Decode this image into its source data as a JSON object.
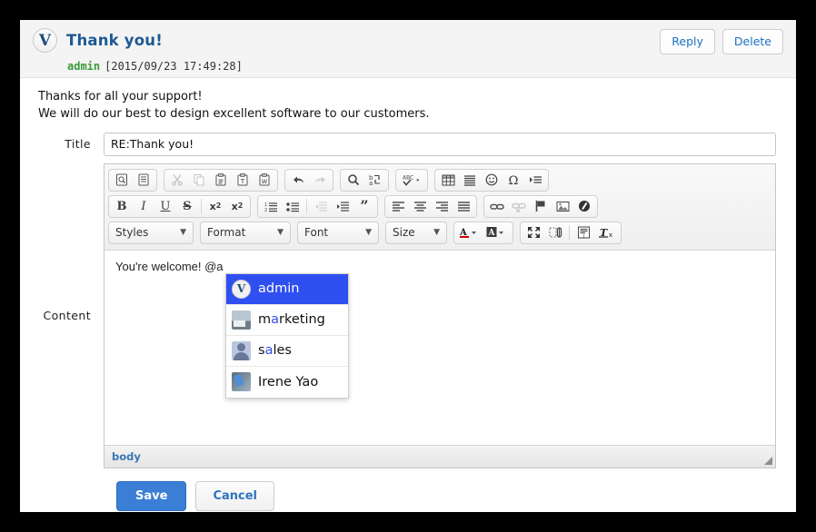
{
  "message": {
    "avatar_letter": "V",
    "title": "Thank you!",
    "author": "admin",
    "timestamp": "[2015/09/23 17:49:28]",
    "body_line1": "Thanks for all your support!",
    "body_line2": "We will do our best to design excellent software to our customers.",
    "reply_label": "Reply",
    "delete_label": "Delete"
  },
  "form": {
    "title_label": "Title",
    "title_value": "RE:Thank you!",
    "title_placeholder": "",
    "content_label": "Content"
  },
  "toolbar": {
    "row1": [
      {
        "group": [
          {
            "name": "preview-icon",
            "glyph": "⌕",
            "disabled": false
          },
          {
            "name": "templates-icon",
            "glyph": "≡",
            "disabled": false
          }
        ]
      },
      {
        "group": [
          {
            "name": "cut-icon",
            "glyph": "✂",
            "disabled": true
          },
          {
            "name": "copy-icon",
            "glyph": "⧉",
            "disabled": true
          },
          {
            "name": "paste-icon",
            "glyph": "Ὄb",
            "disabled": false
          },
          {
            "name": "paste-text-icon",
            "glyph": "T",
            "disabled": false
          },
          {
            "name": "paste-word-icon",
            "glyph": "W",
            "disabled": false
          }
        ]
      },
      {
        "group": [
          {
            "name": "undo-icon",
            "glyph": "↶",
            "disabled": false
          },
          {
            "name": "redo-icon",
            "glyph": "↷",
            "disabled": true
          }
        ]
      },
      {
        "group": [
          {
            "name": "find-icon",
            "glyph": "ὐd",
            "disabled": false
          },
          {
            "name": "replace-icon",
            "glyph": "ba",
            "disabled": false
          }
        ]
      },
      {
        "group": [
          {
            "name": "spellcheck-icon",
            "glyph": "ABC",
            "disabled": false
          }
        ]
      },
      {
        "group": [
          {
            "name": "table-icon",
            "glyph": "▦",
            "disabled": false
          },
          {
            "name": "horizontal-rule-icon",
            "glyph": "☰",
            "disabled": false
          },
          {
            "name": "smiley-icon",
            "glyph": "☺",
            "disabled": false
          },
          {
            "name": "special-character-icon",
            "glyph": "Ω",
            "disabled": false
          },
          {
            "name": "page-break-icon",
            "glyph": "⇥",
            "disabled": false
          }
        ]
      }
    ],
    "row2": [
      {
        "group": [
          {
            "name": "bold-icon",
            "glyph": "B",
            "disabled": false
          },
          {
            "name": "italic-icon",
            "glyph": "I",
            "disabled": false
          },
          {
            "name": "underline-icon",
            "glyph": "U",
            "disabled": false
          },
          {
            "name": "strikethrough-icon",
            "glyph": "S",
            "disabled": false
          },
          {
            "name": "subscript-icon",
            "glyph": "x₂",
            "disabled": false
          },
          {
            "name": "superscript-icon",
            "glyph": "x²",
            "disabled": false
          }
        ]
      },
      {
        "group": [
          {
            "name": "numbered-list-icon",
            "glyph": "1.",
            "disabled": false
          },
          {
            "name": "bulleted-list-icon",
            "glyph": "•",
            "disabled": false
          },
          {
            "name": "decrease-indent-icon",
            "glyph": "←",
            "disabled": true
          },
          {
            "name": "increase-indent-icon",
            "glyph": "→",
            "disabled": false
          },
          {
            "name": "blockquote-icon",
            "glyph": "”",
            "disabled": false
          }
        ]
      },
      {
        "group": [
          {
            "name": "align-left-icon",
            "glyph": "≡",
            "disabled": false
          },
          {
            "name": "align-center-icon",
            "glyph": "≡",
            "disabled": false
          },
          {
            "name": "align-right-icon",
            "glyph": "≡",
            "disabled": false
          },
          {
            "name": "justify-icon",
            "glyph": "≡",
            "disabled": false
          }
        ]
      },
      {
        "group": [
          {
            "name": "link-icon",
            "glyph": "ὑ7",
            "disabled": false
          },
          {
            "name": "unlink-icon",
            "glyph": "ὑ7",
            "disabled": true
          },
          {
            "name": "anchor-icon",
            "glyph": "⚑",
            "disabled": false
          },
          {
            "name": "image-icon",
            "glyph": "Ὓc",
            "disabled": false
          },
          {
            "name": "flash-icon",
            "glyph": "◐",
            "disabled": false
          }
        ]
      }
    ],
    "dropdowns": [
      {
        "name": "styles-dropdown",
        "label": "Styles"
      },
      {
        "name": "format-dropdown",
        "label": "Format"
      },
      {
        "name": "font-dropdown",
        "label": "Font"
      },
      {
        "name": "size-dropdown",
        "label": "Size"
      }
    ],
    "row3_right": [
      {
        "group": [
          {
            "name": "text-color-icon",
            "glyph": "A",
            "disabled": false,
            "caret": true
          },
          {
            "name": "background-color-icon",
            "glyph": "A",
            "disabled": false,
            "caret": true
          }
        ]
      },
      {
        "group": [
          {
            "name": "maximize-icon",
            "glyph": "⤢",
            "disabled": false
          },
          {
            "name": "show-blocks-icon",
            "glyph": "▧",
            "disabled": false
          },
          {
            "name": "sep",
            "glyph": "",
            "disabled": false
          },
          {
            "name": "paragraph-format-icon",
            "glyph": "¶",
            "disabled": false
          },
          {
            "name": "remove-format-icon",
            "glyph": "Tx",
            "disabled": false
          }
        ]
      }
    ]
  },
  "editor": {
    "content_text": "You're welcome! @a",
    "status_path": "body"
  },
  "autocomplete": {
    "items": [
      {
        "name": "admin",
        "prefix": "",
        "match": "a",
        "suffix": "dmin",
        "avatar": "admin-avatar",
        "selected": true
      },
      {
        "name": "marketing",
        "prefix": "m",
        "match": "a",
        "suffix": "rketing",
        "avatar": "marketing-avatar",
        "selected": false
      },
      {
        "name": "sales",
        "prefix": "s",
        "match": "a",
        "suffix": "les",
        "avatar": "sales-avatar",
        "selected": false
      },
      {
        "name": "Irene Yao",
        "prefix": "Irene Y",
        "match": "a",
        "suffix": "o",
        "avatar": "irene-avatar",
        "selected": false
      }
    ]
  },
  "footer": {
    "save_label": "Save",
    "cancel_label": "Cancel"
  },
  "colors": {
    "accent_blue": "#3a7fd5",
    "link_blue": "#1c6fc4",
    "selection_blue": "#2f4ff0",
    "user_green": "#3a9a3a",
    "title_blue": "#1d5a94"
  }
}
